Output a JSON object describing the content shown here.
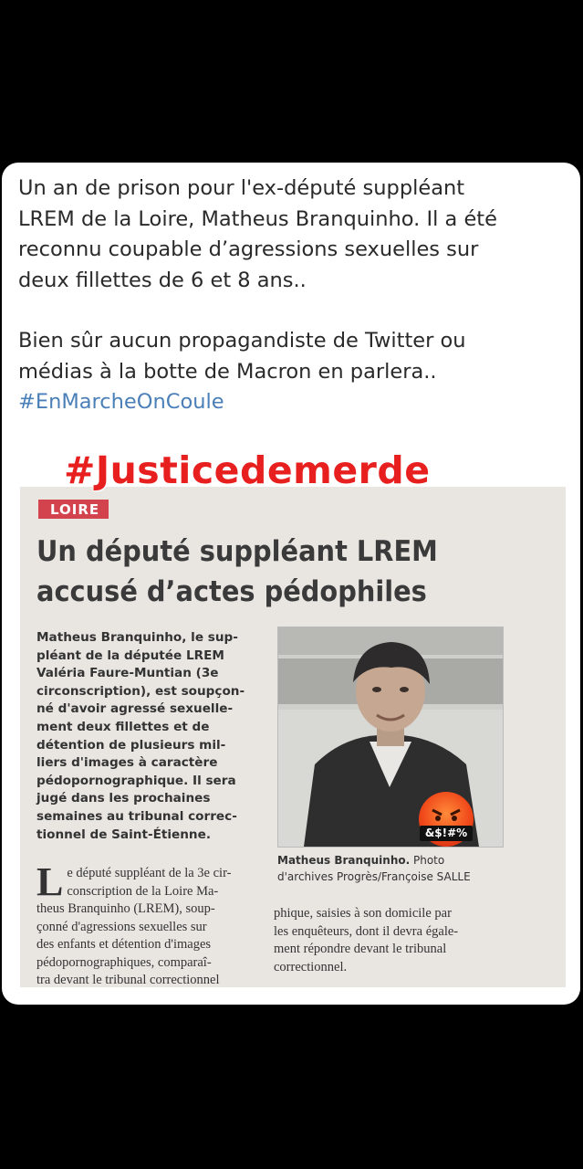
{
  "tweet": {
    "lines": [
      "Un an de prison pour l'ex-député suppléant",
      "LREM de la Loire, Matheus Branquinho. Il a été",
      "reconnu coupable d’agressions sexuelles sur",
      "deux fillettes de 6 et 8 ans.."
    ],
    "lines2": [
      "Bien sûr aucun propagandiste de Twitter ou",
      "médias à la botte de Macron en parlera.."
    ],
    "hashtag": "#EnMarcheOnCoule"
  },
  "overlay_hashtag": "#Justicedemerde",
  "article": {
    "section": "LOIRE",
    "headline_lines": [
      "Un député suppléant LREM",
      "accusé d’actes pédophiles"
    ],
    "chapeau_lines": [
      "Matheus Branquinho, le sup-",
      "pléant de la députée LREM",
      "Valéria Faure-Muntian (3e",
      "circonscription), est soupçon-",
      "né d'avoir agressé sexuelle-",
      "ment deux fillettes et de",
      "détention de plusieurs mil-",
      "liers d'images à caractère",
      "pédopornographique. Il sera",
      "jugé dans les prochaines",
      "semaines au tribunal correc-",
      "tionnel de Saint-Étienne."
    ],
    "caption_name": "Matheus Branquinho.",
    "caption_credit_1": " Photo",
    "caption_credit_2": "d'archives Progrès/Françoise SALLE",
    "dropcap": "L",
    "body_left_lines": [
      "e député suppléant de la 3e cir-",
      "conscription de la Loire Ma-",
      "theus Branquinho (LREM), soup-",
      "çonné d'agressions sexuelles sur",
      "des enfants et détention d'images",
      "pédopornographiques, comparaî-",
      "tra devant le tribunal correctionnel"
    ],
    "body_right_lines": [
      "phique, saisies à son domicile par",
      "les enquêteurs, dont il devra égale-",
      "ment répondre devant le tribunal",
      "correctionnel."
    ]
  },
  "sticker": {
    "icon": "angry-face-icon",
    "text": "&$!#%"
  },
  "colors": {
    "hashtag": "#4a7fb8",
    "overlay": "#e81f1f",
    "section_tab": "#d2434d"
  }
}
